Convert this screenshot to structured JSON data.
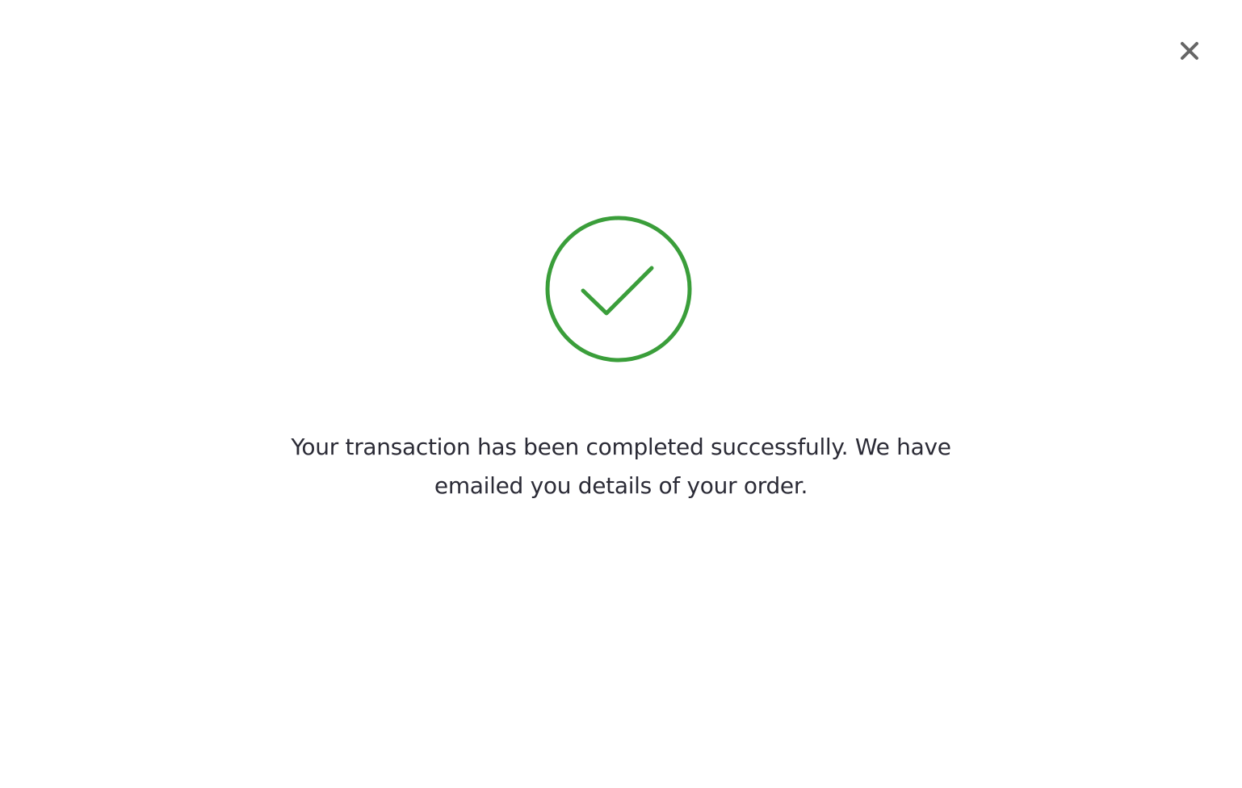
{
  "dialog": {
    "close_icon": "close-icon",
    "success_icon": "check-circle-icon",
    "accent_color": "#3a9e3a",
    "close_color": "#666666",
    "text_color": "#2b2b36",
    "message_line_1": "Your transaction has been completed successfully. We have",
    "message_line_2": "emailed you details of your order."
  }
}
